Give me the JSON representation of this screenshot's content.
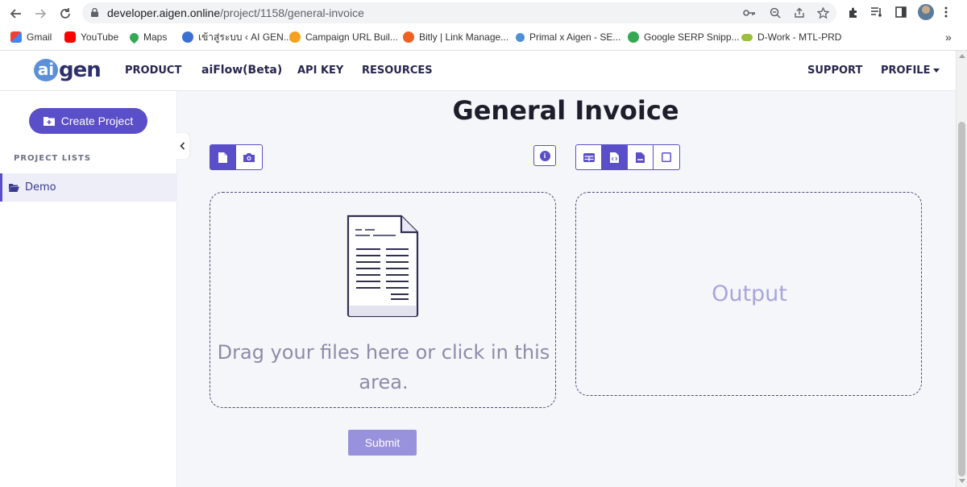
{
  "browser": {
    "url_host": "developer.aigen.online",
    "url_path": "/project/1158/general-invoice",
    "bookmarks": [
      {
        "label": "Gmail",
        "icon": "gmail-icon",
        "color": "#ea4335"
      },
      {
        "label": "YouTube",
        "icon": "youtube-icon",
        "color": "#ff0000"
      },
      {
        "label": "Maps",
        "icon": "maps-icon",
        "color": "#34a853"
      },
      {
        "label": "เข้าสู่ระบบ ‹ AI GEN...",
        "icon": "aigen-icon",
        "color": "#3b6fd1"
      },
      {
        "label": "Campaign URL Buil...",
        "icon": "campaign-icon",
        "color": "#f4a21b"
      },
      {
        "label": "Bitly | Link Manage...",
        "icon": "bitly-icon",
        "color": "#ee6123"
      },
      {
        "label": "Primal x Aigen - SE...",
        "icon": "primal-icon",
        "color": "#4f8fd8"
      },
      {
        "label": "Google SERP Snipp...",
        "icon": "serp-icon",
        "color": "#34a853"
      },
      {
        "label": "D-Work - MTL-PRD",
        "icon": "dwork-icon",
        "color": "#9bbf3a"
      }
    ],
    "more_bookmarks": "»"
  },
  "header": {
    "logo_text": "gen",
    "logo_mark": "ai",
    "menu": {
      "product": "PRODUCT",
      "aiflow": "aiFlow(Beta)",
      "api_key": "API KEY",
      "resources": "RESOURCES",
      "support": "SUPPORT",
      "profile": "PROFILE"
    }
  },
  "sidebar": {
    "create_label": "Create Project",
    "section_label": "PROJECT LISTS",
    "projects": [
      {
        "label": "Demo"
      }
    ]
  },
  "main": {
    "title": "General Invoice",
    "dropzone_text": "Drag your files here or click in this area.",
    "output_placeholder": "Output",
    "submit_label": "Submit"
  },
  "colors": {
    "accent": "#5b4ec9",
    "submit_bg": "#9892dc",
    "output_text": "#a7a5e0"
  }
}
